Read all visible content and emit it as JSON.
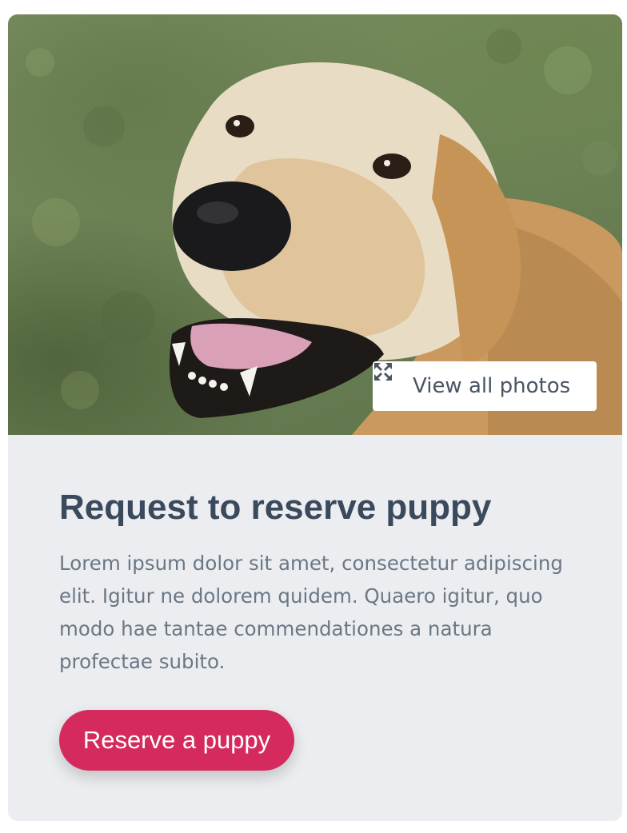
{
  "photo": {
    "alt": "Golden retriever smiling",
    "view_all_label": "View all photos",
    "view_all_icon": "expand-icon"
  },
  "content": {
    "title": "Request to reserve puppy",
    "description": "Lorem ipsum dolor sit amet, consectetur adipiscing elit. Igitur ne dolorem quidem. Quaero igitur, quo modo hae tantae commendationes a natura profectae subito."
  },
  "cta": {
    "label": "Reserve a puppy",
    "color": "#d52a5d"
  }
}
